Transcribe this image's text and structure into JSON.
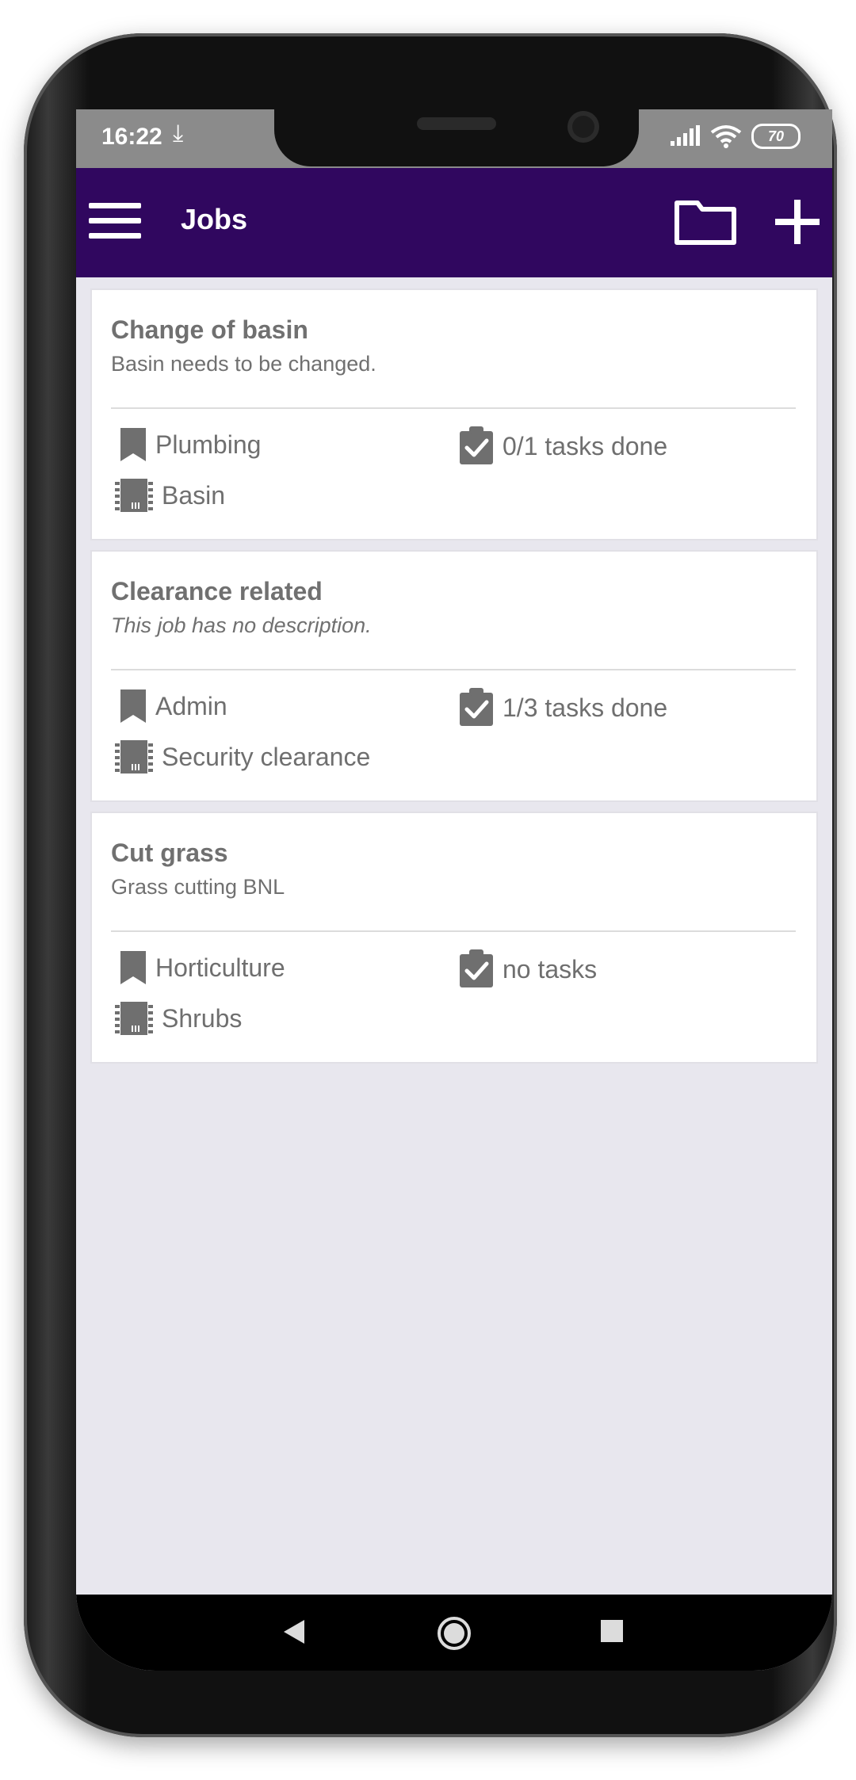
{
  "status_bar": {
    "time": "16:22",
    "download_glyph": "⤓",
    "battery_level": "70"
  },
  "app_bar": {
    "title": "Jobs"
  },
  "colors": {
    "app_bar": "#30075f",
    "background": "#e8e7ee",
    "meta_text": "#6f6f6f"
  },
  "jobs": [
    {
      "title": "Change of basin",
      "description": "Basin needs to be changed.",
      "category": "Plumbing",
      "tasks": "0/1 tasks done",
      "asset": "Basin"
    },
    {
      "title": "Clearance related",
      "description": "This job has no description.",
      "category": "Admin",
      "tasks": "1/3 tasks done",
      "asset": "Security clearance"
    },
    {
      "title": "Cut grass",
      "description": "Grass cutting BNL",
      "category": "Horticulture",
      "tasks": "no tasks",
      "asset": "Shrubs"
    }
  ]
}
